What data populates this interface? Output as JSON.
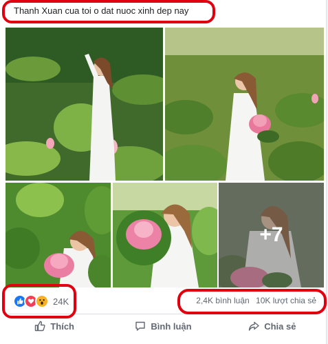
{
  "post": {
    "text": "Thanh Xuan cua toi o dat nuoc xinh dep nay"
  },
  "gallery": {
    "more_count": "+7"
  },
  "reactions": {
    "count": "24K",
    "icons": [
      "like-icon",
      "love-icon",
      "wow-icon"
    ]
  },
  "stats": {
    "comments": "2,4K bình luận",
    "shares": "10K lượt chia sẻ"
  },
  "actions": {
    "like": "Thích",
    "comment": "Bình luận",
    "share": "Chia sẻ"
  },
  "colors": {
    "annotation": "#e0000f",
    "facebook_blue": "#1877f2",
    "muted_text": "#606770"
  }
}
